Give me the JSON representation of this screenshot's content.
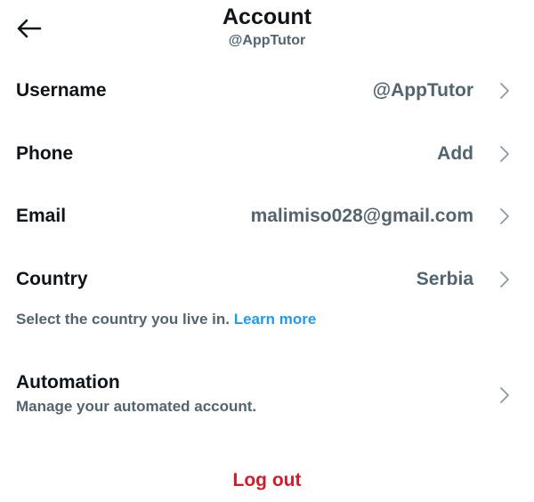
{
  "header": {
    "back_icon": "arrow-left-icon",
    "title": "Account",
    "subtitle": "@AppTutor"
  },
  "rows": [
    {
      "label": "Username",
      "value": "@AppTutor",
      "icon": "chevron-right-icon"
    },
    {
      "label": "Phone",
      "value": "Add",
      "icon": "chevron-right-icon"
    },
    {
      "label": "Email",
      "value": "malimiso028@gmail.com",
      "icon": "chevron-right-icon"
    },
    {
      "label": "Country",
      "value": "Serbia",
      "icon": "chevron-right-icon"
    }
  ],
  "country_hint": {
    "text": "Select the country you live in.",
    "link": "Learn more"
  },
  "automation": {
    "label": "Automation",
    "description": "Manage your automated account.",
    "icon": "chevron-right-icon"
  },
  "logout_label": "Log out",
  "colors": {
    "primary_text": "#0f1419",
    "secondary_text": "#536471",
    "link": "#1d9bf0",
    "danger": "#d41a2a",
    "chevron": "#8b98a5"
  }
}
